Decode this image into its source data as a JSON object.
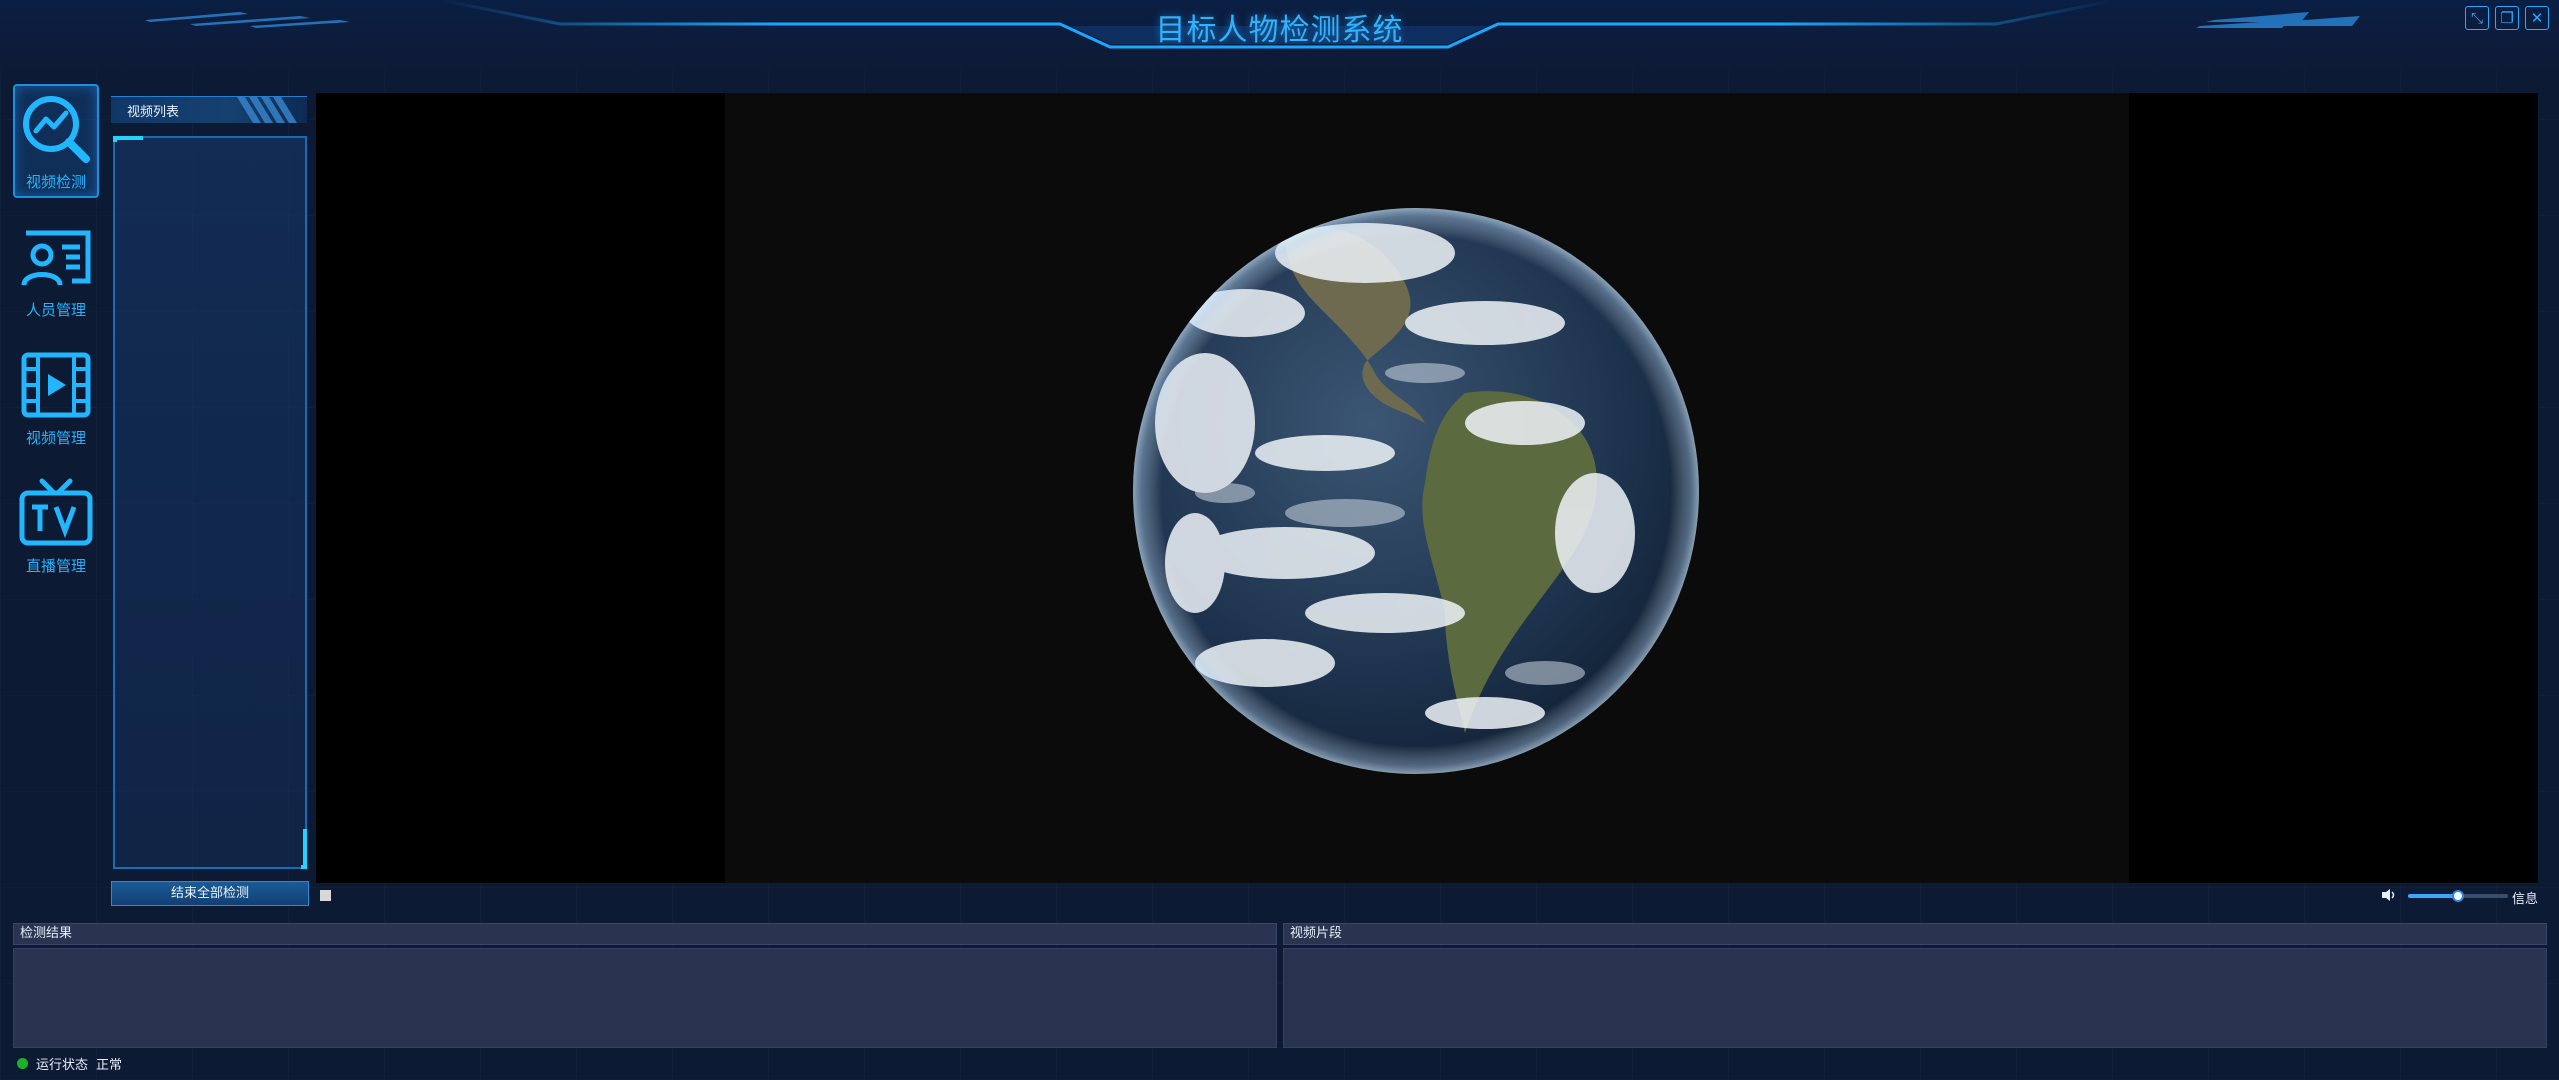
{
  "app": {
    "title": "目标人物检测系统"
  },
  "window_controls": [
    {
      "name": "minimize-button",
      "icon": "minimize-icon",
      "glyph": "⤡"
    },
    {
      "name": "restore-button",
      "icon": "restore-icon",
      "glyph": "❐"
    },
    {
      "name": "close-button",
      "icon": "close-icon",
      "glyph": "✕"
    }
  ],
  "nav": {
    "items": [
      {
        "label": "视频检测",
        "icon": "chart-search-icon",
        "active": true
      },
      {
        "label": "人员管理",
        "icon": "person-card-icon",
        "active": false
      },
      {
        "label": "视频管理",
        "icon": "film-play-icon",
        "active": false
      },
      {
        "label": "直播管理",
        "icon": "tv-icon",
        "active": false
      }
    ]
  },
  "video_list": {
    "title": "视频列表",
    "items": []
  },
  "actions": {
    "end_all_label": "结束全部检测"
  },
  "player": {
    "content": "earth-globe-image",
    "stop_icon": "stop-icon",
    "volume_icon": "volume-icon",
    "volume_level": 0.5,
    "info_label": "信息"
  },
  "results_panel": {
    "title": "检测结果"
  },
  "clips_panel": {
    "title": "视频片段"
  },
  "status": {
    "label": "运行状态",
    "value": "正常",
    "color": "#1db12a"
  },
  "colors": {
    "accent": "#23b4ff",
    "title": "#2fb2ff",
    "background": "#0d1a33"
  }
}
